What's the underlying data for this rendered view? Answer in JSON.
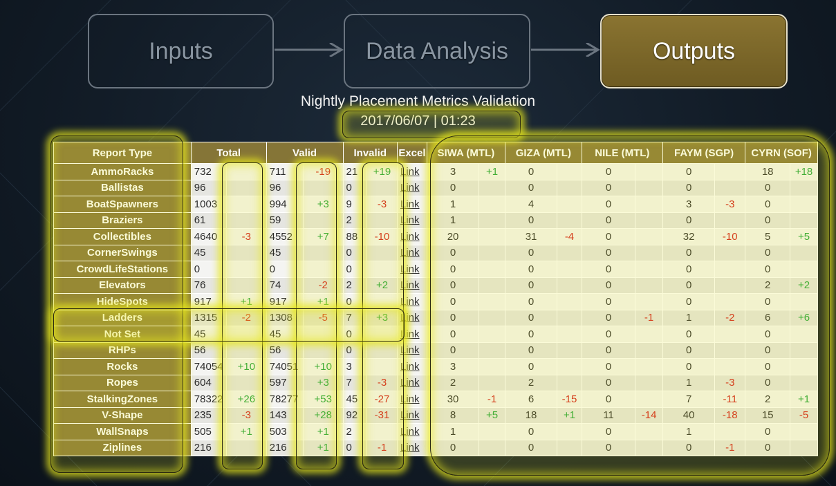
{
  "flow": {
    "step1": "Inputs",
    "step2": "Data Analysis",
    "step3": "Outputs"
  },
  "header": {
    "title": "Nightly Placement Metrics Validation",
    "date": "2017/06/07 | 01:23"
  },
  "table": {
    "columns": {
      "report_type": "Report Type",
      "total": "Total",
      "valid": "Valid",
      "invalid": "Invalid",
      "excel": "Excel",
      "siwa": "SIWA (MTL)",
      "giza": "GIZA (MTL)",
      "nile": "NILE (MTL)",
      "faym": "FAYM (SGP)",
      "cyrn": "CYRN (SOF)"
    },
    "link_label": "Link",
    "rows": [
      {
        "type": "AmmoRacks",
        "total": "732",
        "total_d": "",
        "valid": "711",
        "valid_d": "-19",
        "invalid": "21",
        "invalid_d": "+19",
        "siwa": "3",
        "siwa_d": "+1",
        "giza": "0",
        "giza_d": "",
        "nile": "0",
        "nile_d": "",
        "faym": "0",
        "faym_d": "",
        "cyrn": "18",
        "cyrn_d": "+18"
      },
      {
        "type": "Ballistas",
        "total": "96",
        "total_d": "",
        "valid": "96",
        "valid_d": "",
        "invalid": "0",
        "invalid_d": "",
        "siwa": "0",
        "siwa_d": "",
        "giza": "0",
        "giza_d": "",
        "nile": "0",
        "nile_d": "",
        "faym": "0",
        "faym_d": "",
        "cyrn": "0",
        "cyrn_d": ""
      },
      {
        "type": "BoatSpawners",
        "total": "1003",
        "total_d": "",
        "valid": "994",
        "valid_d": "+3",
        "invalid": "9",
        "invalid_d": "-3",
        "siwa": "1",
        "siwa_d": "",
        "giza": "4",
        "giza_d": "",
        "nile": "0",
        "nile_d": "",
        "faym": "3",
        "faym_d": "-3",
        "cyrn": "0",
        "cyrn_d": ""
      },
      {
        "type": "Braziers",
        "total": "61",
        "total_d": "",
        "valid": "59",
        "valid_d": "",
        "invalid": "2",
        "invalid_d": "",
        "siwa": "1",
        "siwa_d": "",
        "giza": "0",
        "giza_d": "",
        "nile": "0",
        "nile_d": "",
        "faym": "0",
        "faym_d": "",
        "cyrn": "0",
        "cyrn_d": ""
      },
      {
        "type": "Collectibles",
        "total": "4640",
        "total_d": "-3",
        "valid": "4552",
        "valid_d": "+7",
        "invalid": "88",
        "invalid_d": "-10",
        "siwa": "20",
        "siwa_d": "",
        "giza": "31",
        "giza_d": "-4",
        "nile": "0",
        "nile_d": "",
        "faym": "32",
        "faym_d": "-10",
        "cyrn": "5",
        "cyrn_d": "+5"
      },
      {
        "type": "CornerSwings",
        "total": "45",
        "total_d": "",
        "valid": "45",
        "valid_d": "",
        "invalid": "0",
        "invalid_d": "",
        "siwa": "0",
        "siwa_d": "",
        "giza": "0",
        "giza_d": "",
        "nile": "0",
        "nile_d": "",
        "faym": "0",
        "faym_d": "",
        "cyrn": "0",
        "cyrn_d": ""
      },
      {
        "type": "CrowdLifeStations",
        "total": "0",
        "total_d": "",
        "valid": "0",
        "valid_d": "",
        "invalid": "0",
        "invalid_d": "",
        "siwa": "0",
        "siwa_d": "",
        "giza": "0",
        "giza_d": "",
        "nile": "0",
        "nile_d": "",
        "faym": "0",
        "faym_d": "",
        "cyrn": "0",
        "cyrn_d": ""
      },
      {
        "type": "Elevators",
        "total": "76",
        "total_d": "",
        "valid": "74",
        "valid_d": "-2",
        "invalid": "2",
        "invalid_d": "+2",
        "siwa": "0",
        "siwa_d": "",
        "giza": "0",
        "giza_d": "",
        "nile": "0",
        "nile_d": "",
        "faym": "0",
        "faym_d": "",
        "cyrn": "2",
        "cyrn_d": "+2"
      },
      {
        "type": "HideSpots",
        "total": "917",
        "total_d": "+1",
        "valid": "917",
        "valid_d": "+1",
        "invalid": "0",
        "invalid_d": "",
        "siwa": "0",
        "siwa_d": "",
        "giza": "0",
        "giza_d": "",
        "nile": "0",
        "nile_d": "",
        "faym": "0",
        "faym_d": "",
        "cyrn": "0",
        "cyrn_d": ""
      },
      {
        "type": "Ladders",
        "total": "1315",
        "total_d": "-2",
        "valid": "1308",
        "valid_d": "-5",
        "invalid": "7",
        "invalid_d": "+3",
        "siwa": "0",
        "siwa_d": "",
        "giza": "0",
        "giza_d": "",
        "nile": "0",
        "nile_d": "-1",
        "faym": "1",
        "faym_d": "-2",
        "cyrn": "6",
        "cyrn_d": "+6"
      },
      {
        "type": "Not Set",
        "total": "45",
        "total_d": "",
        "valid": "45",
        "valid_d": "",
        "invalid": "0",
        "invalid_d": "",
        "siwa": "0",
        "siwa_d": "",
        "giza": "0",
        "giza_d": "",
        "nile": "0",
        "nile_d": "",
        "faym": "0",
        "faym_d": "",
        "cyrn": "0",
        "cyrn_d": ""
      },
      {
        "type": "RHPs",
        "total": "56",
        "total_d": "",
        "valid": "56",
        "valid_d": "",
        "invalid": "0",
        "invalid_d": "",
        "siwa": "0",
        "siwa_d": "",
        "giza": "0",
        "giza_d": "",
        "nile": "0",
        "nile_d": "",
        "faym": "0",
        "faym_d": "",
        "cyrn": "0",
        "cyrn_d": ""
      },
      {
        "type": "Rocks",
        "total": "74054",
        "total_d": "+10",
        "valid": "74051",
        "valid_d": "+10",
        "invalid": "3",
        "invalid_d": "",
        "siwa": "3",
        "siwa_d": "",
        "giza": "0",
        "giza_d": "",
        "nile": "0",
        "nile_d": "",
        "faym": "0",
        "faym_d": "",
        "cyrn": "0",
        "cyrn_d": ""
      },
      {
        "type": "Ropes",
        "total": "604",
        "total_d": "",
        "valid": "597",
        "valid_d": "+3",
        "invalid": "7",
        "invalid_d": "-3",
        "siwa": "2",
        "siwa_d": "",
        "giza": "2",
        "giza_d": "",
        "nile": "0",
        "nile_d": "",
        "faym": "1",
        "faym_d": "-3",
        "cyrn": "0",
        "cyrn_d": ""
      },
      {
        "type": "StalkingZones",
        "total": "78322",
        "total_d": "+26",
        "valid": "78277",
        "valid_d": "+53",
        "invalid": "45",
        "invalid_d": "-27",
        "siwa": "30",
        "siwa_d": "-1",
        "giza": "6",
        "giza_d": "-15",
        "nile": "0",
        "nile_d": "",
        "faym": "7",
        "faym_d": "-11",
        "cyrn": "2",
        "cyrn_d": "+1"
      },
      {
        "type": "V-Shape",
        "total": "235",
        "total_d": "-3",
        "valid": "143",
        "valid_d": "+28",
        "invalid": "92",
        "invalid_d": "-31",
        "siwa": "8",
        "siwa_d": "+5",
        "giza": "18",
        "giza_d": "+1",
        "nile": "11",
        "nile_d": "-14",
        "faym": "40",
        "faym_d": "-18",
        "cyrn": "15",
        "cyrn_d": "-5"
      },
      {
        "type": "WallSnaps",
        "total": "505",
        "total_d": "+1",
        "valid": "503",
        "valid_d": "+1",
        "invalid": "2",
        "invalid_d": "",
        "siwa": "1",
        "siwa_d": "",
        "giza": "0",
        "giza_d": "",
        "nile": "0",
        "nile_d": "",
        "faym": "1",
        "faym_d": "",
        "cyrn": "0",
        "cyrn_d": ""
      },
      {
        "type": "Ziplines",
        "total": "216",
        "total_d": "",
        "valid": "216",
        "valid_d": "+1",
        "invalid": "0",
        "invalid_d": "-1",
        "siwa": "0",
        "siwa_d": "",
        "giza": "0",
        "giza_d": "",
        "nile": "0",
        "nile_d": "",
        "faym": "0",
        "faym_d": "-1",
        "cyrn": "0",
        "cyrn_d": ""
      }
    ]
  },
  "colors": {
    "header_bg": "#857537",
    "positive": "#1fa23a",
    "negative": "#d11b1b",
    "highlight": "#e6e61e"
  }
}
